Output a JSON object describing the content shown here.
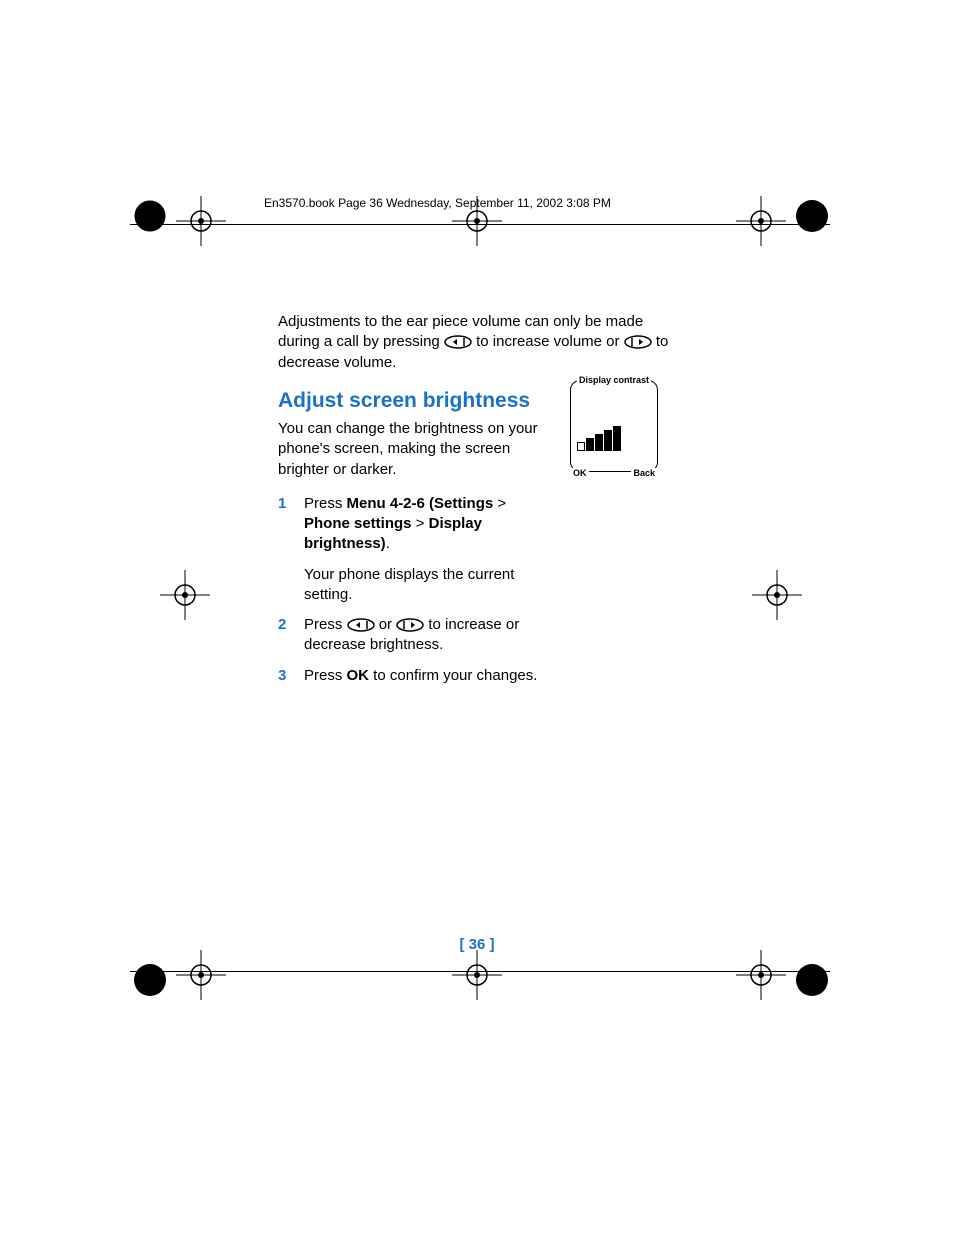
{
  "header": "En3570.book  Page 36  Wednesday, September 11, 2002  3:08 PM",
  "intro": {
    "part1": "Adjustments to the ear piece volume can only be made during a call by pressing ",
    "part2": " to increase volume or ",
    "part3": " to decrease volume."
  },
  "heading": "Adjust screen brightness",
  "desc": "You can change the brightness on your phone's screen, making the screen brighter or darker.",
  "steps": [
    {
      "num": "1",
      "pre": "Press ",
      "bold1": "Menu 4-2-6 (Settings",
      "mid1": " > ",
      "bold2": "Phone settings",
      "mid2": " > ",
      "bold3": "Display brightness)",
      "post": ".",
      "follow": "Your phone displays the current setting."
    },
    {
      "num": "2",
      "pre": "Press ",
      "mid": " or ",
      "post": " to increase or decrease brightness."
    },
    {
      "num": "3",
      "pre": "Press ",
      "bold": "OK",
      "post": " to confirm your changes."
    }
  ],
  "screen": {
    "title": "Display contrast",
    "left": "OK",
    "right": "Back"
  },
  "pagenum": "[ 36 ]"
}
